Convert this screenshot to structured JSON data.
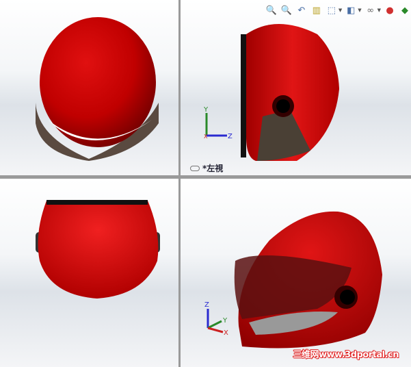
{
  "toolbar": {
    "items": [
      {
        "icon": "zoom-to-fit-icon",
        "glyph": "🔍"
      },
      {
        "icon": "zoom-to-area-icon",
        "glyph": "🔍"
      },
      {
        "icon": "previous-view-icon",
        "glyph": "↶"
      },
      {
        "icon": "section-view-icon",
        "glyph": "▥"
      },
      {
        "icon": "view-orientation-icon",
        "glyph": "⬚"
      },
      {
        "icon": "display-style-icon",
        "glyph": "◧"
      },
      {
        "icon": "hide-show-items-icon",
        "glyph": "∞"
      },
      {
        "icon": "edit-appearance-icon",
        "glyph": "●"
      },
      {
        "icon": "apply-scene-icon",
        "glyph": "◆"
      }
    ]
  },
  "viewports": {
    "top_right": {
      "label": "*左視",
      "triad": {
        "up": "Y",
        "right": "Z",
        "origin": "X"
      }
    },
    "bottom_right": {
      "triad": {
        "up": "Z",
        "right": "Y",
        "front": "X"
      }
    }
  },
  "watermark": "三维网www.3dportal.cn",
  "colors": {
    "helmet_red": "#cc0000",
    "visor": "#4a3a30",
    "axis_x": "#cc2020",
    "axis_y": "#2a8a2a",
    "axis_z": "#2a2ad0"
  }
}
